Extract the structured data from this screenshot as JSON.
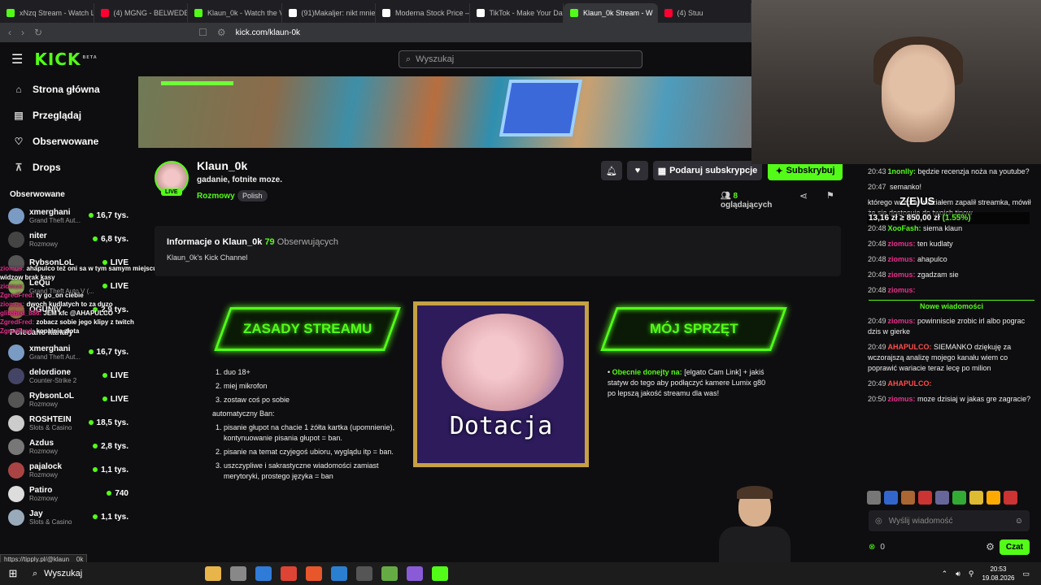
{
  "browser": {
    "tabs": [
      {
        "title": "xNzq Stream - Watch Live",
        "color": "#53fc18",
        "active": false
      },
      {
        "title": "(4) MGNG - BELWEDER (o",
        "color": "#ff0033",
        "active": false
      },
      {
        "title": "Klaun_0k - Watch the VOD",
        "color": "#53fc18",
        "active": false
      },
      {
        "title": "(91)Makaljer: nikt mnie nie",
        "color": "#ffffff",
        "active": false
      },
      {
        "title": "Moderna Stock Price — M",
        "color": "#ffffff",
        "active": false
      },
      {
        "title": "TikTok - Make Your Day",
        "color": "#ffffff",
        "active": false
      },
      {
        "title": "Klaun_0k Stream - W",
        "color": "#53fc18",
        "active": true
      },
      {
        "title": "(4) Stuu",
        "color": "#ff0033",
        "active": false
      }
    ],
    "close_glyph": "✕",
    "url": "kick.com/klaun-0k"
  },
  "header": {
    "logo": "KICK",
    "logo_badge": "BETA",
    "search_placeholder": "Wyszukaj"
  },
  "sidebar": {
    "nav": [
      {
        "label": "Strona główna",
        "icon": "⌂"
      },
      {
        "label": "Przeglądaj",
        "icon": "▤"
      },
      {
        "label": "Obserwowane",
        "icon": "♡"
      },
      {
        "label": "Drops",
        "icon": "⊼"
      }
    ],
    "followed_title": "Obserwowane",
    "followed": [
      {
        "name": "xmerghani",
        "category": "Grand Theft Aut...",
        "viewers": "16,7 tys.",
        "color": "#7a9bc4"
      },
      {
        "name": "niter",
        "category": "Rozmowy",
        "viewers": "6,8 tys.",
        "color": "#444"
      },
      {
        "name": "RybsonLoL",
        "category": "",
        "viewers": "LIVE",
        "color": "#555"
      },
      {
        "name": "LeQu",
        "category": "Grand Theft Auto V (...",
        "viewers": "LIVE",
        "color": "#8a5"
      },
      {
        "name": "OGUNIV",
        "category": "",
        "viewers": "2,9 tys.",
        "color": "#964"
      }
    ],
    "recommended_title": "Polecane kanały",
    "recommended": [
      {
        "name": "xmerghani",
        "category": "Grand Theft Aut...",
        "viewers": "16,7 tys.",
        "color": "#7a9bc4"
      },
      {
        "name": "delordione",
        "category": "Counter-Strike 2",
        "viewers": "LIVE",
        "color": "#446"
      },
      {
        "name": "RybsonLoL",
        "category": "Rozmowy",
        "viewers": "LIVE",
        "color": "#555"
      },
      {
        "name": "ROSHTEIN",
        "category": "Slots & Casino",
        "viewers": "18,5 tys.",
        "color": "#ccc"
      },
      {
        "name": "Azdus",
        "category": "Rozmowy",
        "viewers": "2,8 tys.",
        "color": "#777"
      },
      {
        "name": "pajalock",
        "category": "Rozmowy",
        "viewers": "1,1 tys.",
        "color": "#a44"
      },
      {
        "name": "Patiro",
        "category": "Rozmowy",
        "viewers": "740",
        "color": "#ddd"
      },
      {
        "name": "Jay",
        "category": "Slots & Casino",
        "viewers": "1,1 tys.",
        "color": "#9ab"
      }
    ]
  },
  "overlay_chat": [
    {
      "user": "ziomus:",
      "text": "ahapulco też oni sa w tym samym miejscu, brak widzow brak kasy"
    },
    {
      "user": "ziomus:",
      "text": ""
    },
    {
      "user": "ZgredFred:",
      "text": "ty go_on ciebie"
    },
    {
      "user": "ziomus:",
      "text": "dwoch kudlatych to za duzo"
    },
    {
      "user": "glitched_886:",
      "text": "JEM kfc @AHAPULCO"
    },
    {
      "user": "ZgredFred:",
      "text": "zobacz sobie jego klipy z twitch"
    },
    {
      "user": "ZgredFred:",
      "text": "kopalnia złota"
    }
  ],
  "status_url": "https://tipply.pl/@klaun__0k",
  "stream_progress": 0.35,
  "channel": {
    "name": "Klaun_0k",
    "live": "LIVE",
    "title": "gadanie, fotnite moze.",
    "category": "Rozmowy",
    "language": "Polish",
    "subscribe_gift": "Podaruj subskrypcje",
    "subscribe": "Subskrybuj",
    "viewers_count": "8",
    "viewers_label": "oglądających"
  },
  "about": {
    "heading": "Informacje o Klaun_0k",
    "followers": "79",
    "followers_label": "Obserwujących",
    "description": "Klaun_0k's Kick Channel"
  },
  "panels": {
    "rules_title": "ZASADY STREAMU",
    "rules_list": [
      "duo 18+",
      "miej mikrofon",
      "zostaw coś po sobie"
    ],
    "auto_ban_label": "automatyczny Ban:",
    "ban_list": [
      "pisanie głupot na chacie 1 żółta kartka (upomnienie), kontynuowanie pisania głupot = ban.",
      "pisanie na temat czyjegoś ubioru, wyglądu itp = ban.",
      "uszczypliwe i sakrastyczne wiadomości zamiast merytoryki, prostego języka = ban"
    ],
    "donate_text": "Dotacja",
    "gear_title": "MÓJ SPRZĘT",
    "gear_highlight": "Obecnie donejty na:",
    "gear_text": "[elgato Cam Link] + jakiś statyw do tego aby podłączyć kamere Lumix g80 po lepszą jakość streamu dla was!"
  },
  "chat_overlay": {
    "name": "Z(E)US",
    "price": "13,16 zł",
    "sep": " ≥ ",
    "price2": "850,00 zł",
    "change": "(1.55%)"
  },
  "chat": {
    "messages": [
      {
        "time": "20:43",
        "user": "1nonlly:",
        "color": "#53fc18",
        "text": "będzie recenzja noża na youtube?"
      },
      {
        "time": "20:47",
        "user": "",
        "color": "#e8308c",
        "text": "semanko!"
      },
      {
        "time": "",
        "user": "",
        "color": "#e8308c",
        "text": "którego wczoraj widziałem zapalił streamka, mówił że się dostosuje do twoich tipow"
      },
      {
        "time": "20:48",
        "user": "XooFash:",
        "color": "#53fc18",
        "text": "siema klaun"
      },
      {
        "time": "20:48",
        "user": "ziomus:",
        "color": "#e8308c",
        "text": "ten kudlaty"
      },
      {
        "time": "20:48",
        "user": "ziomus:",
        "color": "#e8308c",
        "text": "ahapulco"
      },
      {
        "time": "20:48",
        "user": "ziomus:",
        "color": "#e8308c",
        "text": "zgadzam sie"
      },
      {
        "time": "20:48",
        "user": "ziomus:",
        "color": "#e8308c",
        "text": ""
      }
    ],
    "new_messages_label": "Nowe wiadomości",
    "new_messages": [
      {
        "time": "20:49",
        "user": "ziomus:",
        "color": "#e8308c",
        "text": "powinniscie zrobic irl albo pograc dzis w gierke"
      },
      {
        "time": "20:49",
        "user": "AHAPULCO:",
        "color": "#ff4d4d",
        "text": "SIEMANKO dziękuję za wczorajszą analizę mojego kanału wiem co poprawić wariacie teraz lecę po milion"
      },
      {
        "time": "20:49",
        "user": "AHAPULCO:",
        "color": "#ff4d4d",
        "text": ""
      },
      {
        "time": "20:50",
        "user": "ziomus:",
        "color": "#e8308c",
        "text": "moze dzisiaj w jakas gre zagracie?"
      }
    ],
    "emote_colors": [
      "#777",
      "#36c",
      "#a63",
      "#c33",
      "#669",
      "#3a3",
      "#db3",
      "#fa0",
      "#c33"
    ],
    "input_placeholder": "Wyślij wiadomość",
    "points": "0",
    "send_label": "Czat"
  },
  "taskbar": {
    "search": "Wyszukaj",
    "apps": [
      "#e8b54a",
      "#888",
      "#2f7bd8",
      "#dd4433",
      "#e8562b",
      "#2b7fd0",
      "#555",
      "#6a4",
      "#8a5bd6",
      "#53fc18"
    ],
    "time": "20:53",
    "date": "19.08.2026"
  }
}
